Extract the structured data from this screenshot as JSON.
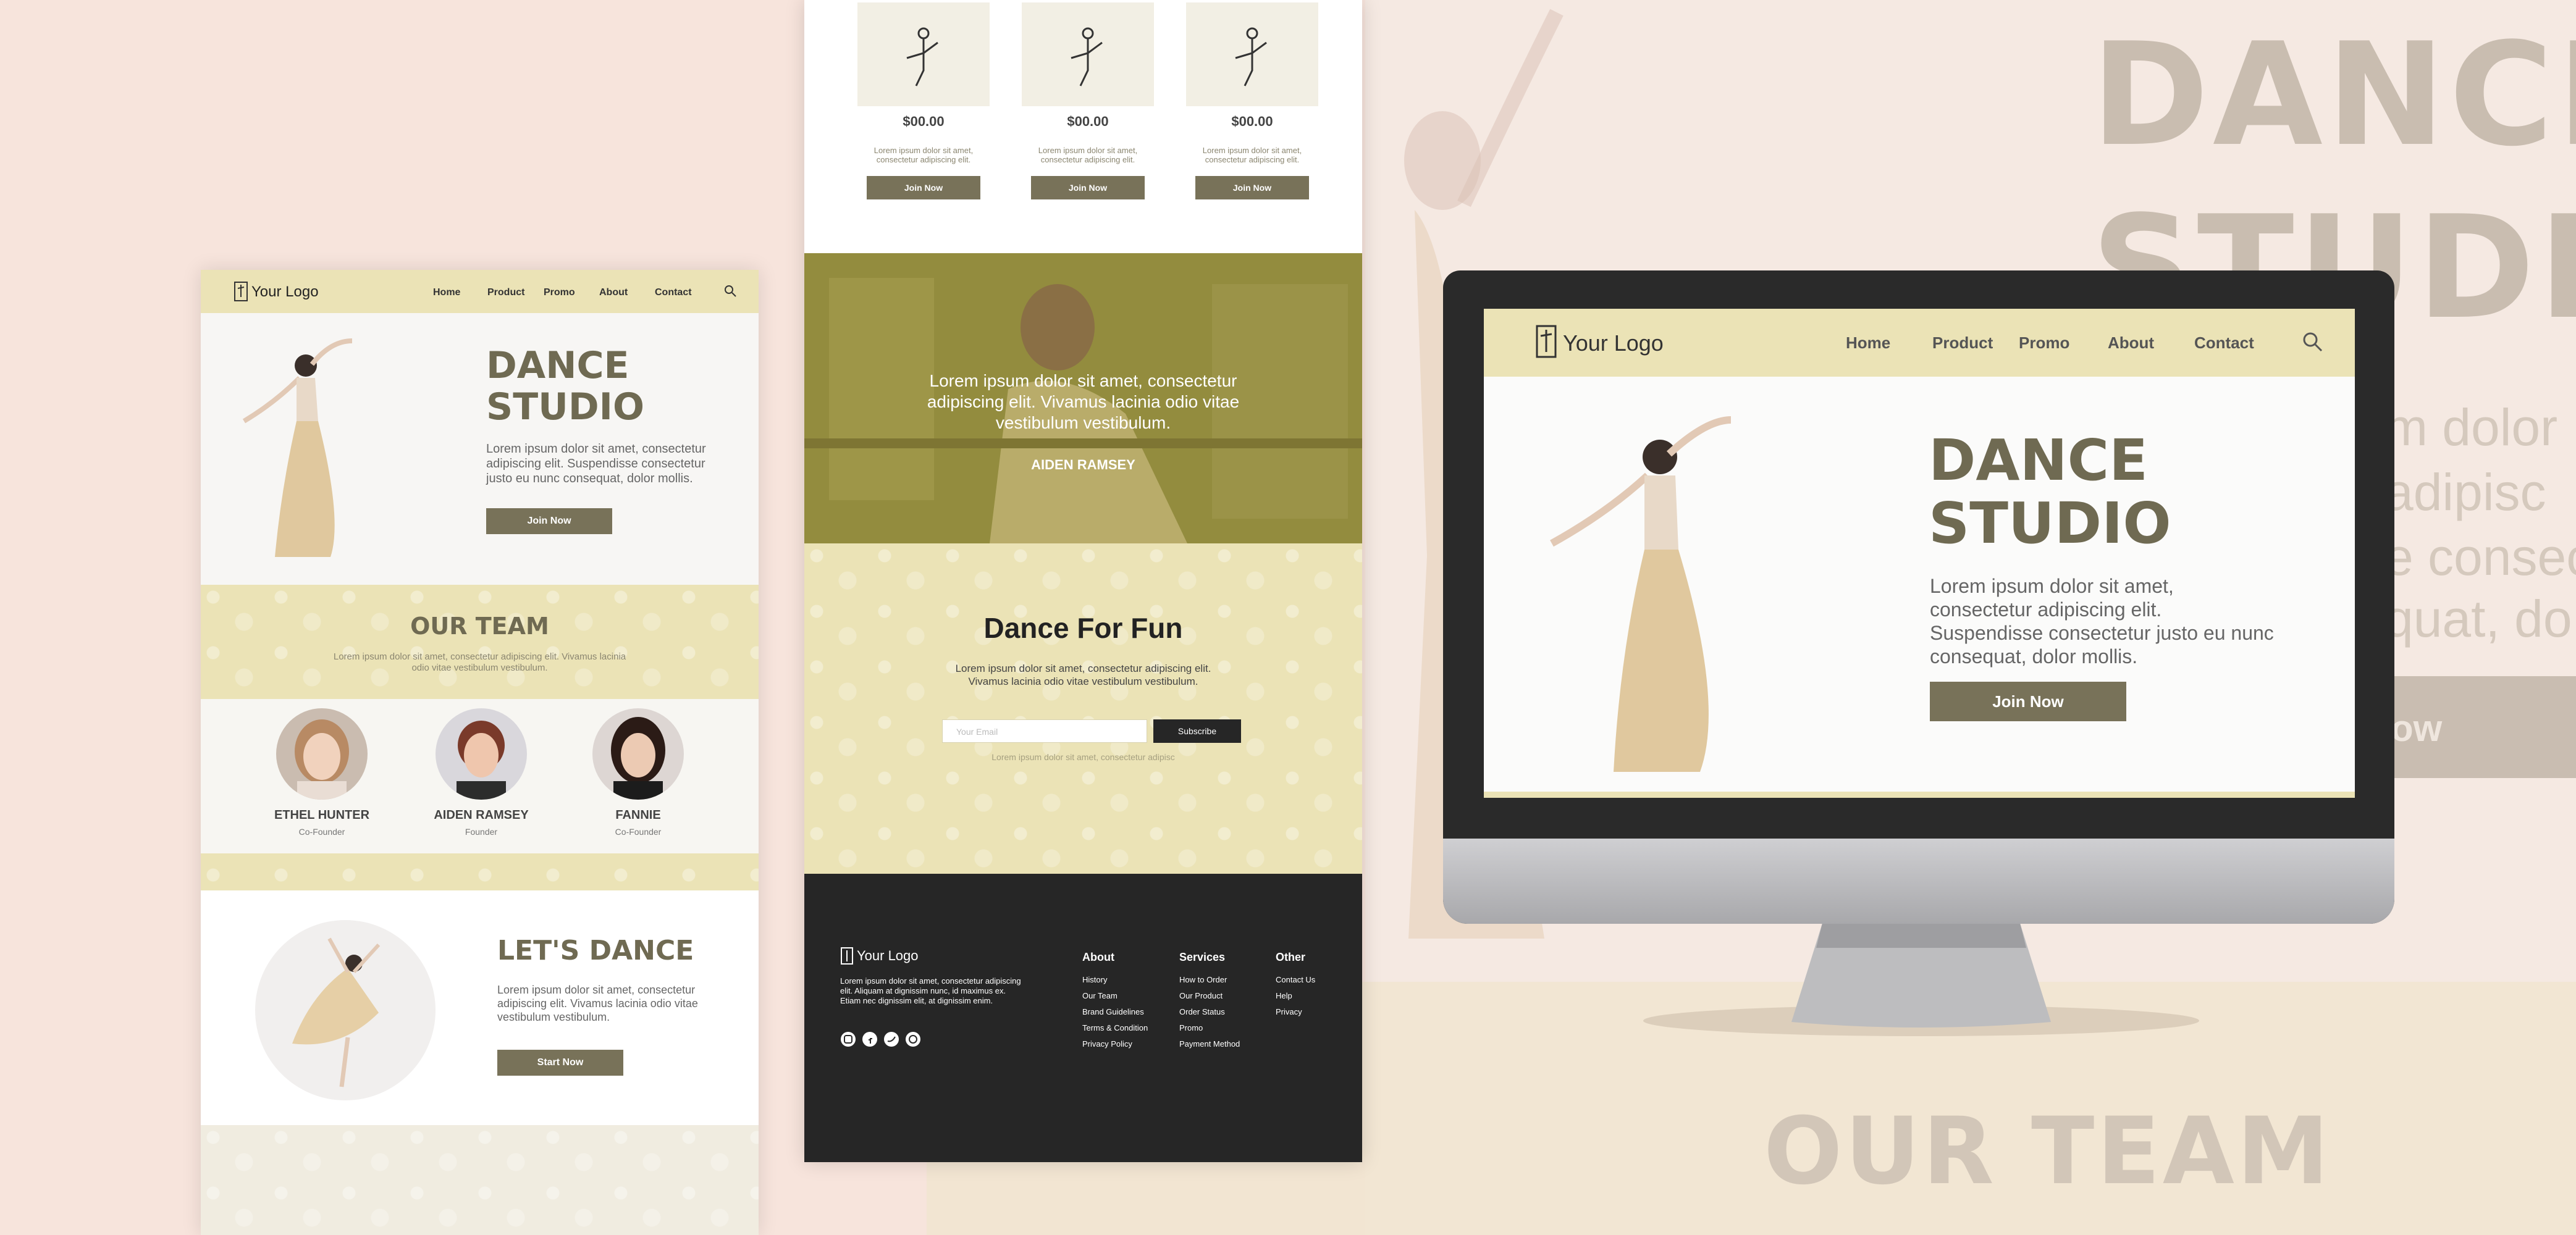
{
  "brand": {
    "logo_text": "Your Logo"
  },
  "nav": {
    "items": [
      "Home",
      "Product",
      "Promo",
      "About",
      "Contact"
    ]
  },
  "hero": {
    "title_line1": "DANCE",
    "title_line2": "STUDIO",
    "body": "Lorem ipsum dolor sit amet, consectetur adipiscing elit. Suspendisse consectetur justo eu nunc consequat, dolor mollis.",
    "cta": "Join Now"
  },
  "team": {
    "title": "OUR TEAM",
    "body": "Lorem ipsum dolor sit amet, consectetur adipiscing elit. Vivamus lacinia odio vitae vestibulum vestibulum.",
    "members": [
      {
        "name": "ETHEL HUNTER",
        "role": "Co-Founder"
      },
      {
        "name": "AIDEN RAMSEY",
        "role": "Founder"
      },
      {
        "name": "FANNIE",
        "role": "Co-Founder"
      }
    ]
  },
  "lets_dance": {
    "title": "LET'S DANCE",
    "body": "Lorem ipsum dolor sit amet, consectetur adipiscing elit. Vivamus lacinia odio vitae vestibulum vestibulum.",
    "cta": "Start Now"
  },
  "products": [
    {
      "price": "$00.00",
      "desc": "Lorem ipsum dolor sit amet, consectetur adipiscing elit.",
      "cta": "Join Now"
    },
    {
      "price": "$00.00",
      "desc": "Lorem ipsum dolor sit amet, consectetur adipiscing elit.",
      "cta": "Join Now"
    },
    {
      "price": "$00.00",
      "desc": "Lorem ipsum dolor sit amet, consectetur adipiscing elit.",
      "cta": "Join Now"
    }
  ],
  "testimonial": {
    "quote": "Lorem ipsum dolor sit amet, consectetur adipiscing elit. Vivamus lacinia odio vitae vestibulum vestibulum.",
    "author": "AIDEN RAMSEY"
  },
  "newsletter": {
    "title": "Dance For Fun",
    "body": "Lorem ipsum dolor sit amet, consectetur adipiscing elit. Vivamus lacinia odio vitae vestibulum vestibulum.",
    "email_placeholder": "Your Email",
    "subscribe": "Subscribe",
    "note": "Lorem ipsum dolor sit amet, consectetur adipisc"
  },
  "footer": {
    "about_text": "Lorem ipsum dolor sit amet, consectetur adipiscing elit. Aliquam at dignissim nunc, id maximus ex. Etiam nec dignissim elit, at dignissim enim.",
    "columns": [
      {
        "title": "About",
        "links": [
          "History",
          "Our Team",
          "Brand Guidelines",
          "Terms & Condition",
          "Privacy Policy"
        ]
      },
      {
        "title": "Services",
        "links": [
          "How to Order",
          "Our Product",
          "Order Status",
          "Promo",
          "Payment Method"
        ]
      },
      {
        "title": "Other",
        "links": [
          "Contact Us",
          "Help",
          "Privacy"
        ]
      }
    ]
  },
  "backdrop": {
    "title_line1": "DANCE",
    "title_line2": "STUDIO",
    "fragment_1": "m dolor",
    "fragment_2": "adipisc",
    "fragment_3": "e consec",
    "fragment_4": "quat, do",
    "button_fragment": "ow",
    "team_title": "OUR TEAM"
  },
  "colors": {
    "accent": "#787259",
    "cream": "#ebe3b6",
    "dark_footer": "#262626",
    "background": "#f7e4dc"
  }
}
